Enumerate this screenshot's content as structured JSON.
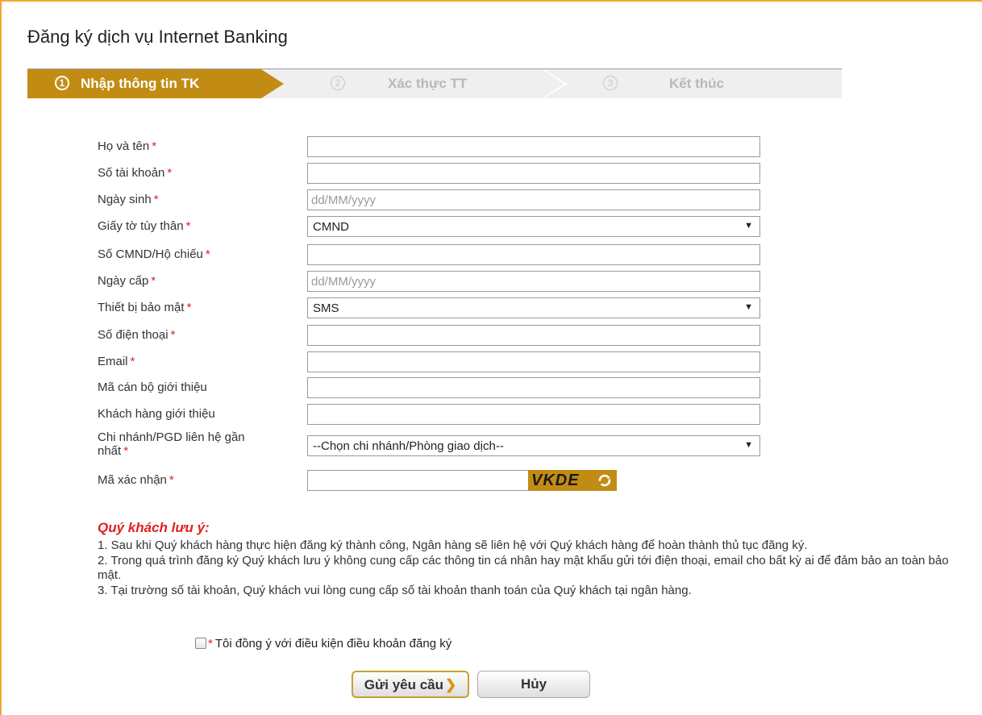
{
  "page_title": "Đăng ký dịch vụ Internet Banking",
  "steps": [
    {
      "num": "1",
      "label": "Nhập thông tin TK"
    },
    {
      "num": "2",
      "label": "Xác thực TT"
    },
    {
      "num": "3",
      "label": "Kết thúc"
    }
  ],
  "required_mark": "*",
  "form": {
    "full_name_label": "Họ và tên",
    "account_no_label": "Số tài khoản",
    "dob_label": "Ngày sinh",
    "dob_placeholder": "dd/MM/yyyy",
    "id_doc_label": "Giấy tờ tùy thân",
    "id_doc_value": "CMND",
    "id_no_label": "Số CMND/Hộ chiếu",
    "issue_date_label": "Ngày cấp",
    "issue_date_placeholder": "dd/MM/yyyy",
    "security_device_label": "Thiết bị bảo mật",
    "security_device_value": "SMS",
    "phone_label": "Số điện thoại",
    "email_label": "Email",
    "referrer_staff_label": "Mã cán bộ giới thiệu",
    "referrer_customer_label": "Khách hàng giới thiệu",
    "branch_label": "Chi nhánh/PGD liên hệ gần nhất",
    "branch_value": "--Chọn chi nhánh/Phòng giao dịch--",
    "captcha_label": "Mã xác nhận",
    "captcha_code": "VKDE"
  },
  "notes": {
    "title": "Quý khách lưu ý:",
    "items": [
      "1. Sau khi Quý khách hàng thực hiện đăng ký thành công, Ngân hàng sẽ liên hệ với Quý khách hàng để hoàn thành thủ tục đăng ký.",
      "2. Trong quá trình đăng ký Quý khách lưu ý không cung cấp các thông tin cá nhân hay mật khẩu gửi tới điện thoại, email cho bất kỳ ai để đảm bảo an toàn bảo mật.",
      "3. Tại trường số tài khoản, Quý khách vui lòng cung cấp số tài khoản thanh toán của Quý khách tại ngân hàng."
    ]
  },
  "agree_text": "Tôi đồng ý với điều kiện điều khoản đăng ký",
  "buttons": {
    "submit": "Gửi yêu cầu",
    "cancel": "Hủy"
  },
  "colors": {
    "accent": "#c28c14",
    "frame": "#f0a830",
    "required": "#e02020"
  },
  "icons": {
    "select_caret": "▼",
    "submit_arrow": "❯"
  }
}
